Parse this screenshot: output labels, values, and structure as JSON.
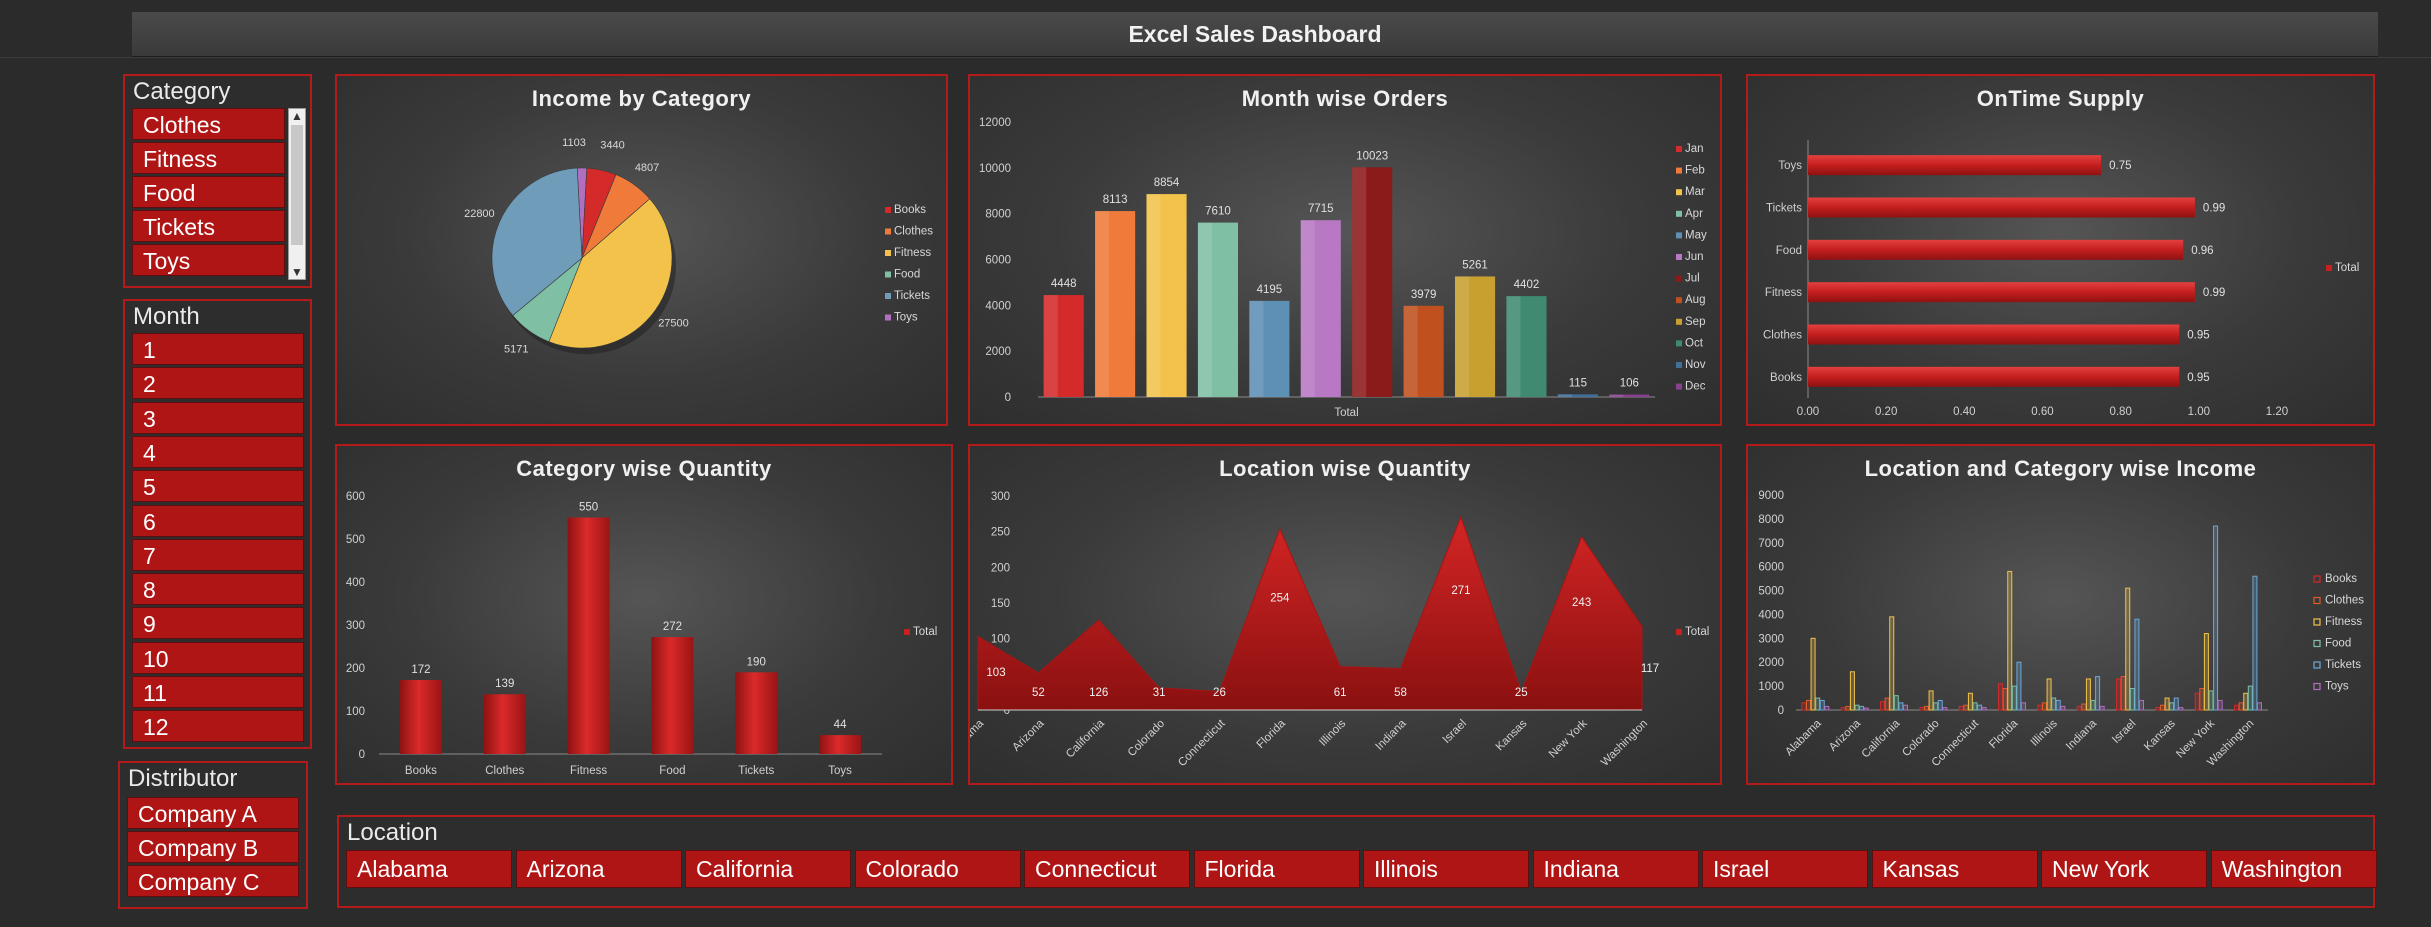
{
  "dashboard": {
    "title": "Excel Sales Dashboard"
  },
  "slicers": {
    "category": {
      "title": "Category",
      "items": [
        "Clothes",
        "Fitness",
        "Food",
        "Tickets",
        "Toys"
      ]
    },
    "month": {
      "title": "Month",
      "items": [
        "1",
        "2",
        "3",
        "4",
        "5",
        "6",
        "7",
        "8",
        "9",
        "10",
        "11",
        "12"
      ]
    },
    "distributor": {
      "title": "Distributor",
      "items": [
        "Company A",
        "Company B",
        "Company C"
      ]
    },
    "location": {
      "title": "Location",
      "items": [
        "Alabama",
        "Arizona",
        "California",
        "Colorado",
        "Connecticut",
        "Florida",
        "Illinois",
        "Indiana",
        "Israel",
        "Kansas",
        "New York",
        "Washington"
      ]
    }
  },
  "icons": {
    "scroll_up": "chevron-up-icon",
    "scroll_down": "chevron-down-icon"
  },
  "colors": {
    "accent": "#b31a1a",
    "bar_red": "#c62020"
  },
  "chart_data": [
    {
      "type": "pie",
      "title": "Income by Category",
      "categories": [
        "Books",
        "Clothes",
        "Fitness",
        "Food",
        "Tickets",
        "Toys"
      ],
      "values": [
        3440,
        4807,
        27500,
        5171,
        22800,
        1103
      ],
      "colors": [
        "#d42a2a",
        "#f07a3a",
        "#f2c24a",
        "#7fbfa4",
        "#6f9cb8",
        "#b06fc0"
      ],
      "legend": "right"
    },
    {
      "type": "bar",
      "title": "Month wise Orders",
      "categories": [
        "Total"
      ],
      "series": [
        {
          "name": "Jan",
          "values": [
            4448
          ]
        },
        {
          "name": "Feb",
          "values": [
            8113
          ]
        },
        {
          "name": "Mar",
          "values": [
            8854
          ]
        },
        {
          "name": "Apr",
          "values": [
            7610
          ]
        },
        {
          "name": "May",
          "values": [
            4195
          ]
        },
        {
          "name": "Jun",
          "values": [
            7715
          ]
        },
        {
          "name": "Jul",
          "values": [
            10023
          ]
        },
        {
          "name": "Aug",
          "values": [
            3979
          ]
        },
        {
          "name": "Sep",
          "values": [
            5261
          ]
        },
        {
          "name": "Oct",
          "values": [
            4402
          ]
        },
        {
          "name": "Nov",
          "values": [
            115
          ]
        },
        {
          "name": "Dec",
          "values": [
            106
          ]
        }
      ],
      "colors": [
        "#d42a2a",
        "#f07a3a",
        "#f2c24a",
        "#7fbfa4",
        "#5e8fb4",
        "#b878c4",
        "#8b1a1a",
        "#c0501e",
        "#c8a030",
        "#3f8a70",
        "#3f6f9a",
        "#8a3f90"
      ],
      "yticks": [
        0,
        2000,
        4000,
        6000,
        8000,
        10000,
        12000
      ],
      "ylim": [
        0,
        12000
      ],
      "legend": "right"
    },
    {
      "type": "bar",
      "orientation": "horizontal",
      "title": "OnTime Supply",
      "categories": [
        "Toys",
        "Tickets",
        "Food",
        "Fitness",
        "Clothes",
        "Books"
      ],
      "series": [
        {
          "name": "Total",
          "values": [
            0.75,
            0.99,
            0.96,
            0.99,
            0.95,
            0.95
          ]
        }
      ],
      "xticks": [
        "0.00",
        "0.20",
        "0.40",
        "0.60",
        "0.80",
        "1.00",
        "1.20"
      ],
      "xlim": [
        0,
        1.2
      ],
      "legend": "right"
    },
    {
      "type": "bar",
      "title": "Category wise Quantity",
      "categories": [
        "Books",
        "Clothes",
        "Fitness",
        "Food",
        "Tickets",
        "Toys"
      ],
      "series": [
        {
          "name": "Total",
          "values": [
            172,
            139,
            550,
            272,
            190,
            44
          ]
        }
      ],
      "yticks": [
        0,
        100,
        200,
        300,
        400,
        500,
        600
      ],
      "ylim": [
        0,
        600
      ],
      "legend": "right"
    },
    {
      "type": "area",
      "title": "Location wise Quantity",
      "categories": [
        "Alabama",
        "Arizona",
        "California",
        "Colorado",
        "Connecticut",
        "Florida",
        "Illinois",
        "Indiana",
        "Israel",
        "Kansas",
        "New York",
        "Washington"
      ],
      "series": [
        {
          "name": "Total",
          "values": [
            103,
            52,
            126,
            31,
            26,
            254,
            61,
            58,
            271,
            25,
            243,
            117
          ]
        }
      ],
      "yticks": [
        0,
        50,
        100,
        150,
        200,
        250,
        300
      ],
      "ylim": [
        0,
        300
      ],
      "legend": "right"
    },
    {
      "type": "bar",
      "title": "Location and Category wise Income",
      "categories": [
        "Alabama",
        "Arizona",
        "California",
        "Colorado",
        "Connecticut",
        "Florida",
        "Illinois",
        "Indiana",
        "Israel",
        "Kansas",
        "New York",
        "Washington"
      ],
      "series": [
        {
          "name": "Books",
          "values": [
            300,
            100,
            350,
            100,
            150,
            1100,
            200,
            150,
            1300,
            100,
            700,
            200
          ]
        },
        {
          "name": "Clothes",
          "values": [
            400,
            150,
            500,
            150,
            200,
            900,
            300,
            250,
            1400,
            200,
            900,
            300
          ]
        },
        {
          "name": "Fitness",
          "values": [
            3000,
            1600,
            3900,
            800,
            700,
            5800,
            1300,
            1300,
            5100,
            500,
            3200,
            700
          ]
        },
        {
          "name": "Food",
          "values": [
            500,
            200,
            600,
            300,
            300,
            1000,
            500,
            400,
            900,
            300,
            800,
            1000
          ]
        },
        {
          "name": "Tickets",
          "values": [
            400,
            150,
            300,
            400,
            200,
            2000,
            400,
            1400,
            3800,
            500,
            7700,
            5600
          ]
        },
        {
          "name": "Toys",
          "values": [
            150,
            80,
            200,
            100,
            100,
            300,
            150,
            150,
            400,
            100,
            400,
            300
          ]
        }
      ],
      "colors": [
        "#d42a2a",
        "#e05a2a",
        "#f2c24a",
        "#7fbfa4",
        "#6aa8d8",
        "#b06fc0"
      ],
      "yticks": [
        0,
        1000,
        2000,
        3000,
        4000,
        5000,
        6000,
        7000,
        8000,
        9000
      ],
      "ylim": [
        0,
        9000
      ],
      "legend": "right"
    }
  ]
}
